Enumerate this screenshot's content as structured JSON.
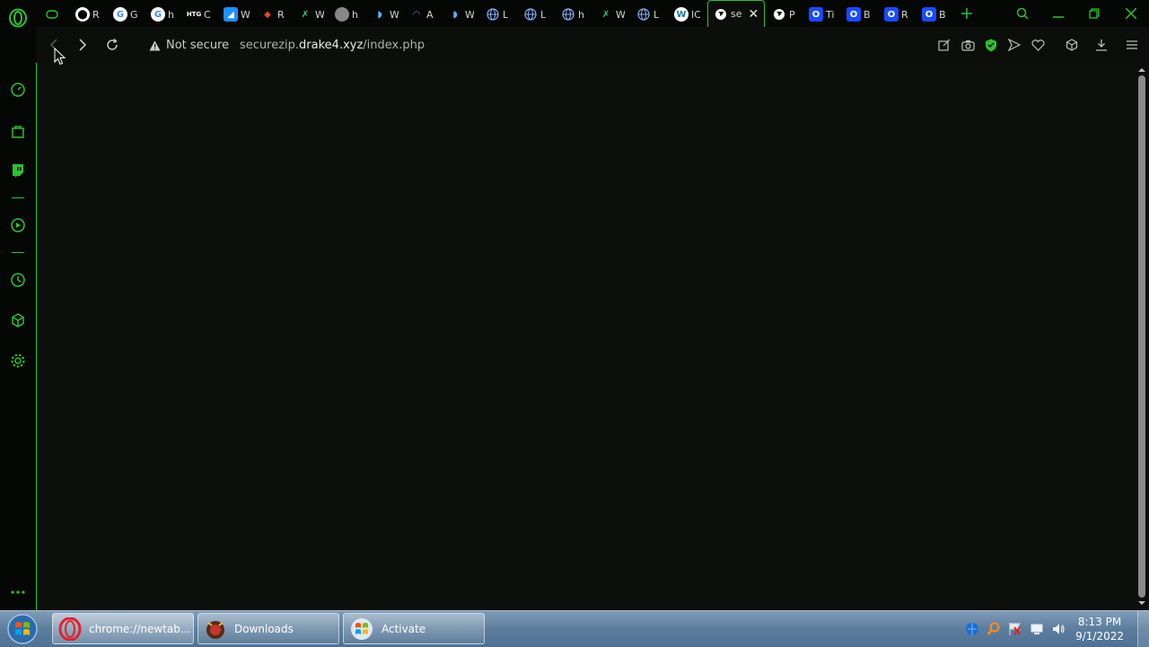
{
  "browser": {
    "tabs": [
      {
        "icon": "gamepad-icon",
        "label": ""
      },
      {
        "icon": "github-icon",
        "label": "R"
      },
      {
        "icon": "google-icon",
        "label": "G"
      },
      {
        "icon": "google-icon",
        "label": "h"
      },
      {
        "icon": "htg-icon",
        "label": "C"
      },
      {
        "icon": "image-icon",
        "label": "W"
      },
      {
        "icon": "diamond-icon",
        "label": "R"
      },
      {
        "icon": "x-logo-icon",
        "label": "W"
      },
      {
        "icon": "sphere-icon",
        "label": "h"
      },
      {
        "icon": "bird-icon",
        "label": "W"
      },
      {
        "icon": "arc-icon",
        "label": "A"
      },
      {
        "icon": "bird-icon",
        "label": "W"
      },
      {
        "icon": "globe-icon",
        "label": "L"
      },
      {
        "icon": "globe-icon",
        "label": "L"
      },
      {
        "icon": "globe-icon",
        "label": "h"
      },
      {
        "icon": "x-logo-icon",
        "label": "W"
      },
      {
        "icon": "globe-icon",
        "label": "L"
      },
      {
        "icon": "wordpress-icon",
        "label": "IC"
      },
      {
        "icon": "globe-icon",
        "label": "se",
        "active": true
      },
      {
        "icon": "globe-icon",
        "label": "P"
      },
      {
        "icon": "opera-blue-icon",
        "label": "Ti"
      },
      {
        "icon": "opera-blue-icon",
        "label": "B"
      },
      {
        "icon": "opera-blue-icon",
        "label": "R"
      },
      {
        "icon": "opera-blue-icon",
        "label": "B"
      }
    ],
    "security_label": "Not secure",
    "url_prefix": "securezip.",
    "url_domain": "drake4.xyz",
    "url_path": "/index.php",
    "accent_color": "#2fc12f"
  },
  "taskbar": {
    "items": [
      {
        "icon": "opera-icon",
        "label": "chrome://newtab..."
      },
      {
        "icon": "downloads-icon",
        "label": "Downloads"
      },
      {
        "icon": "windows-icon",
        "label": "Activate"
      }
    ],
    "time": "8:13 PM",
    "date": "9/1/2022"
  }
}
